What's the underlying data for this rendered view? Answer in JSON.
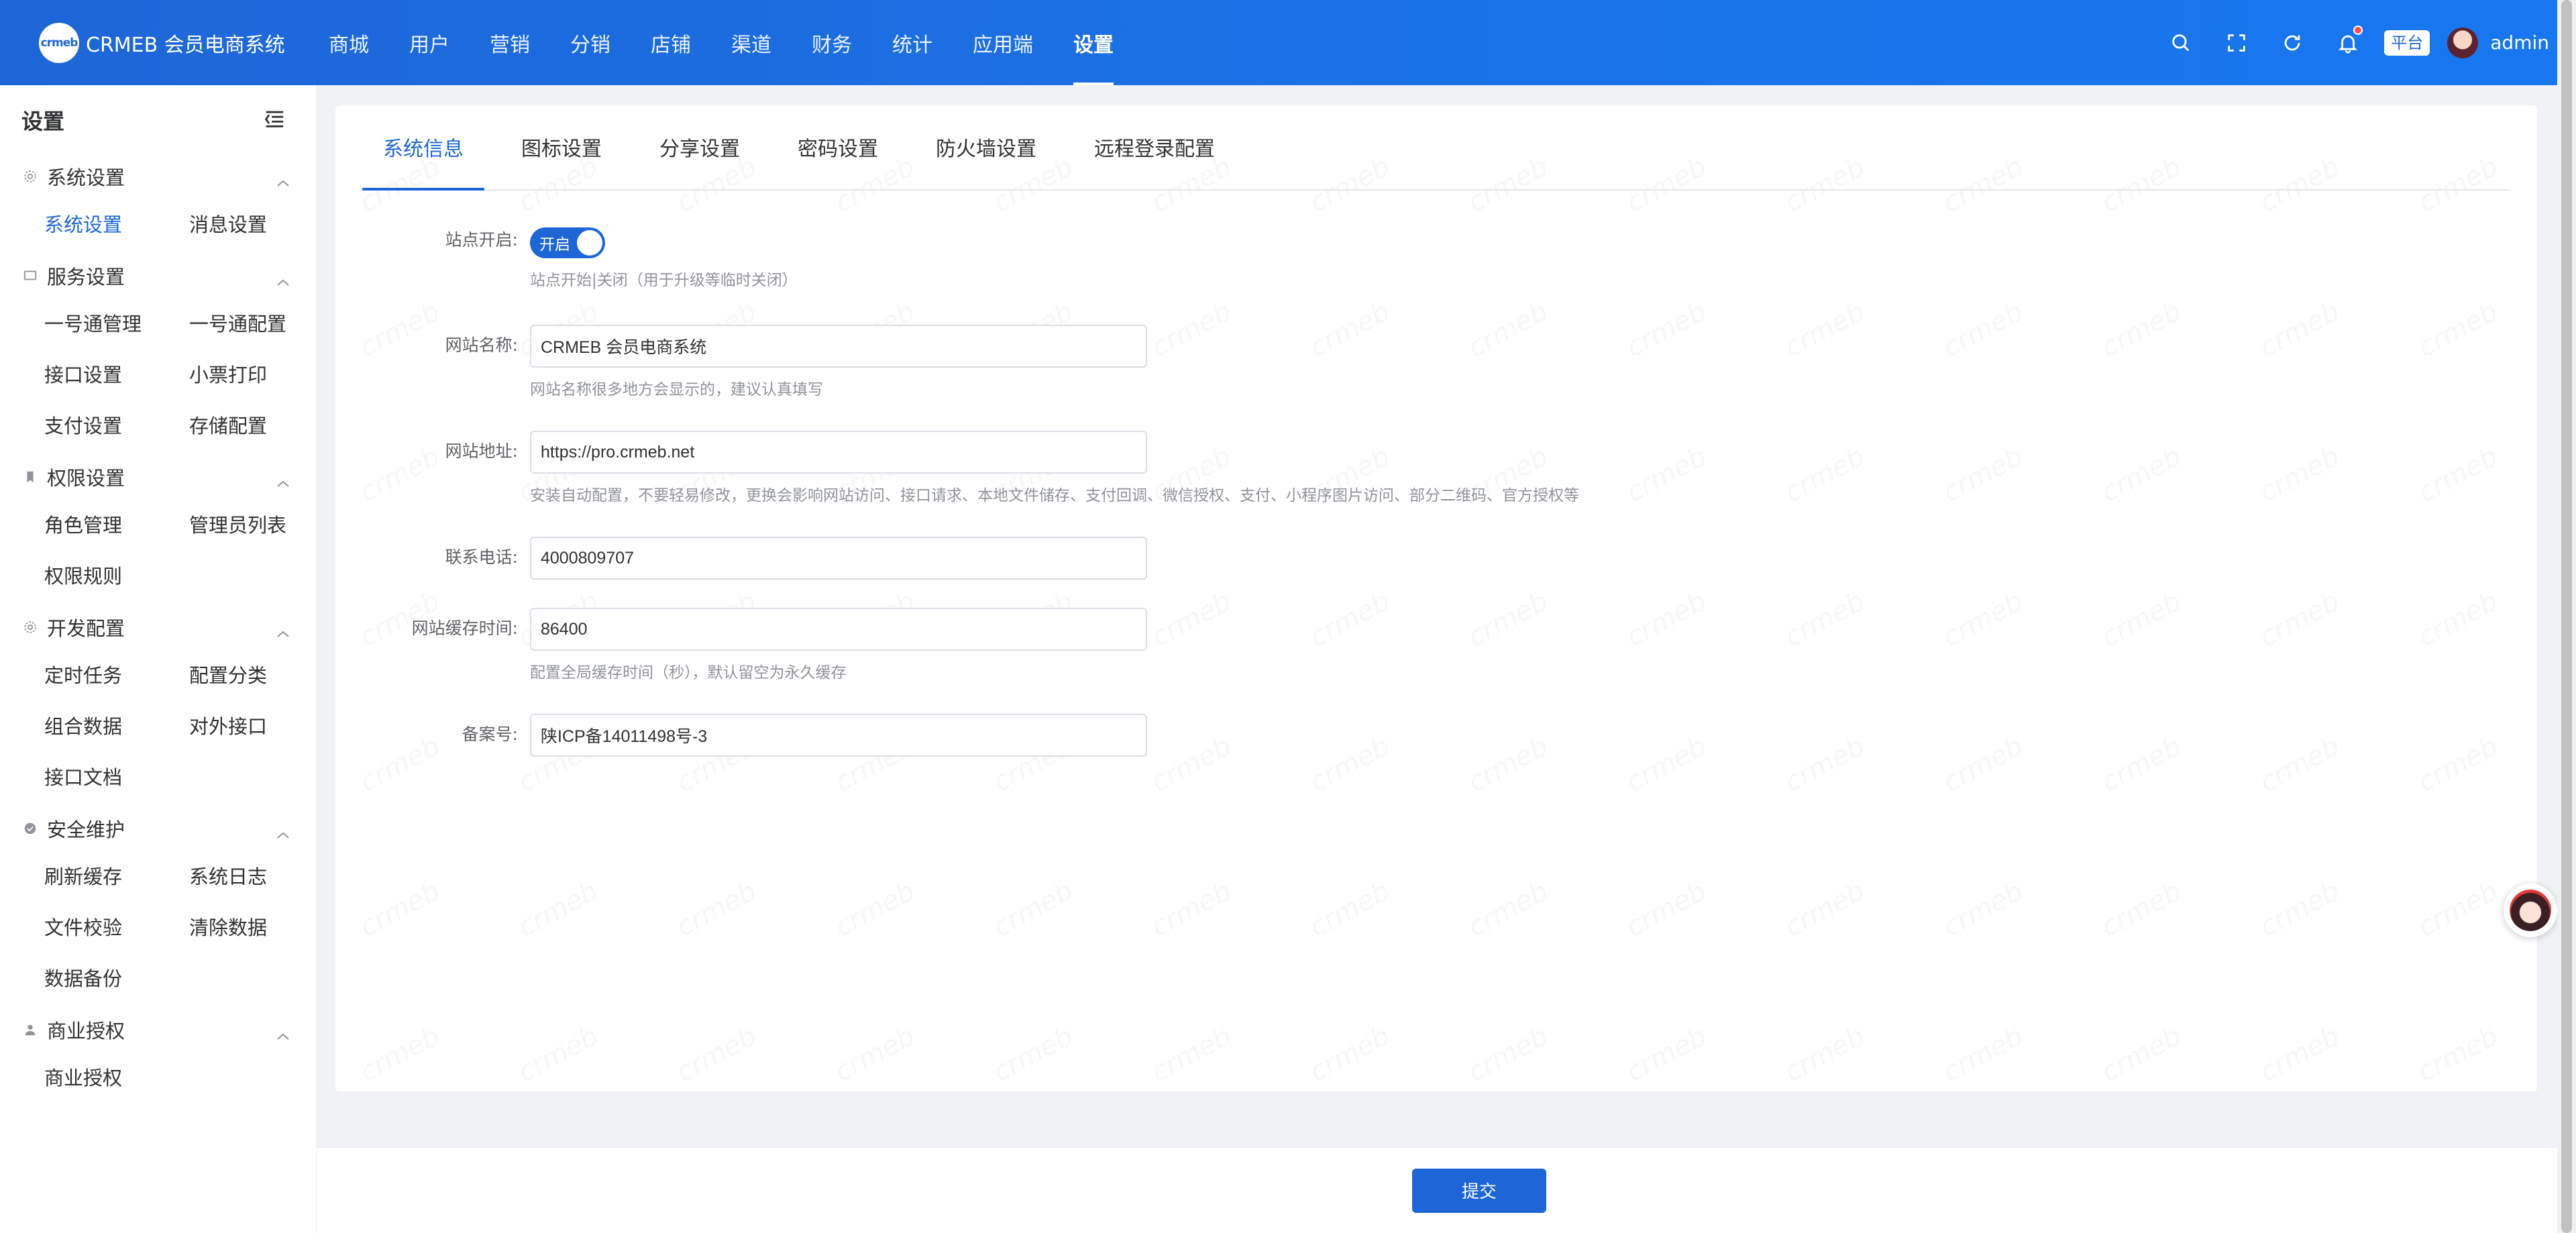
{
  "header": {
    "logo_badge": "crmeb",
    "logo_text": "CRMEB 会员电商系统",
    "nav": [
      "商城",
      "用户",
      "营销",
      "分销",
      "店铺",
      "渠道",
      "财务",
      "统计",
      "应用端",
      "设置"
    ],
    "active_nav": "设置",
    "platform_tag": "平台",
    "username": "admin"
  },
  "sidebar": {
    "title": "设置",
    "groups": [
      {
        "label": "系统设置",
        "icon": "gear-icon",
        "items": [
          "系统设置",
          "消息设置"
        ]
      },
      {
        "label": "服务设置",
        "icon": "monitor-icon",
        "items": [
          "一号通管理",
          "一号通配置",
          "接口设置",
          "小票打印",
          "支付设置",
          "存储配置"
        ]
      },
      {
        "label": "权限设置",
        "icon": "bookmark-icon",
        "items": [
          "角色管理",
          "管理员列表",
          "权限规则"
        ]
      },
      {
        "label": "开发配置",
        "icon": "gear-icon",
        "items": [
          "定时任务",
          "配置分类",
          "组合数据",
          "对外接口",
          "接口文档"
        ]
      },
      {
        "label": "安全维护",
        "icon": "check-circle-icon",
        "items": [
          "刷新缓存",
          "系统日志",
          "文件校验",
          "清除数据",
          "数据备份"
        ]
      },
      {
        "label": "商业授权",
        "icon": "user-icon",
        "items": [
          "商业授权"
        ]
      }
    ]
  },
  "tabs": [
    "系统信息",
    "图标设置",
    "分享设置",
    "密码设置",
    "防火墙设置",
    "远程登录配置"
  ],
  "form": {
    "site_open": {
      "label": "站点开启:",
      "switch_text": "开启",
      "hint": "站点开始|关闭（用于升级等临时关闭）"
    },
    "site_name": {
      "label": "网站名称:",
      "value": "CRMEB 会员电商系统",
      "hint": "网站名称很多地方会显示的，建议认真填写"
    },
    "site_url": {
      "label": "网站地址:",
      "value": "https://pro.crmeb.net",
      "hint": "安装自动配置，不要轻易修改，更换会影响网站访问、接口请求、本地文件储存、支付回调、微信授权、支付、小程序图片访问、部分二维码、官方授权等"
    },
    "phone": {
      "label": "联系电话:",
      "value": "4000809707"
    },
    "cache_time": {
      "label": "网站缓存时间:",
      "value": "86400",
      "hint": "配置全局缓存时间（秒），默认留空为永久缓存"
    },
    "icp": {
      "label": "备案号:",
      "value": "陕ICP备14011498号-3"
    }
  },
  "footer": {
    "submit_label": "提交"
  },
  "colors": {
    "primary": "#1e66d8",
    "header_bg": "#1a73e8",
    "page_bg": "#f0f2f5"
  }
}
